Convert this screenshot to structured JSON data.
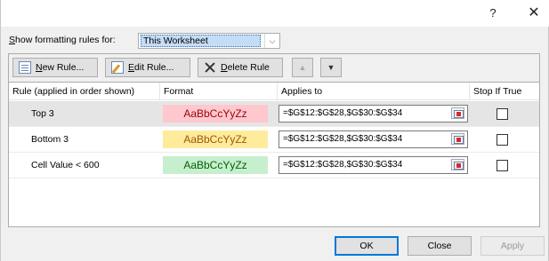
{
  "window": {
    "help_label": "?",
    "close_label": "✕"
  },
  "show_rules": {
    "label_prefix": "S",
    "label_rest": "how formatting rules for:",
    "selected": "This Worksheet",
    "arrow": "⌵"
  },
  "toolbar": {
    "new_rule": {
      "mnemonic": "N",
      "rest": "ew Rule..."
    },
    "edit_rule": {
      "mnemonic": "E",
      "rest": "dit Rule..."
    },
    "delete_rule": {
      "mnemonic": "D",
      "rest": "elete Rule"
    },
    "move_up": "▲",
    "move_down": "▼"
  },
  "columns": {
    "rule": "Rule (applied in order shown)",
    "format": "Format",
    "applies_to": "Applies to",
    "stop_if_true": "Stop If True"
  },
  "rules": [
    {
      "name": "Top 3",
      "preview": "AaBbCcYyZz",
      "applies_to": "=$G$12:$G$28,$G$30:$G$34",
      "stop_if_true": false,
      "fill": "#ffc7ce",
      "font_color": "#9c0006",
      "selected": true
    },
    {
      "name": "Bottom 3",
      "preview": "AaBbCcYyZz",
      "applies_to": "=$G$12:$G$28,$G$30:$G$34",
      "stop_if_true": false,
      "fill": "#ffeb9c",
      "font_color": "#9c5700",
      "selected": false
    },
    {
      "name": "Cell Value < 600",
      "preview": "AaBbCcYyZz",
      "applies_to": "=$G$12:$G$28,$G$30:$G$34",
      "stop_if_true": false,
      "fill": "#c6efce",
      "font_color": "#006100",
      "selected": false
    }
  ],
  "footer": {
    "ok": "OK",
    "close": "Close",
    "apply": "Apply"
  },
  "colors": {
    "accent": "#0078d7",
    "selection": "#c4dcf5"
  }
}
